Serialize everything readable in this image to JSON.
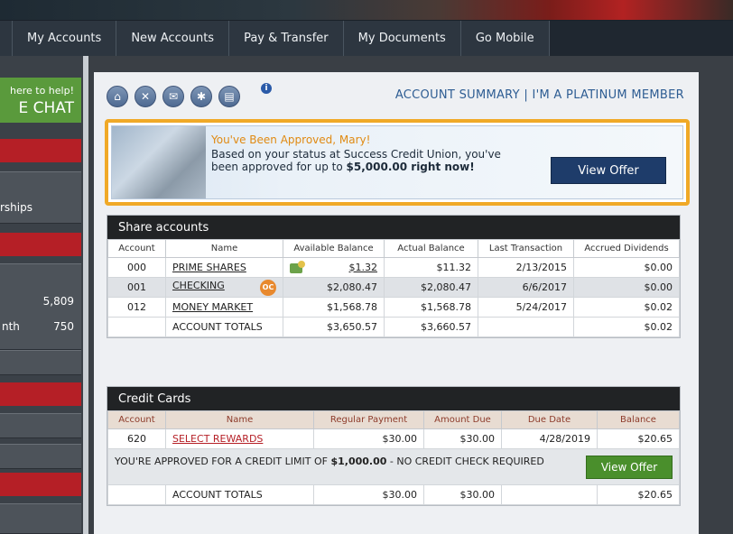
{
  "nav": {
    "tabs": [
      "My Accounts",
      "New Accounts",
      "Pay & Transfer",
      "My Documents",
      "Go Mobile"
    ]
  },
  "sidebar": {
    "help_line1": "here to help!",
    "help_line2": "E CHAT",
    "item_memberships": "rships",
    "row1_value": "5,809",
    "row2_label": "nth",
    "row2_value": "750"
  },
  "toolbar": {
    "icons": [
      "home-icon",
      "tools-icon",
      "mail-icon",
      "gear-icon",
      "print-icon"
    ],
    "info": "i"
  },
  "header": {
    "title": "ACCOUNT SUMMARY | I'M A PLATINUM MEMBER"
  },
  "offer": {
    "title": "You've Been Approved, Mary!",
    "body_prefix": "Based on your status at Success Credit Union, you've been approved for up to ",
    "body_amount": "$5,000.00 right now!",
    "button": "View Offer"
  },
  "share": {
    "heading": "Share accounts",
    "columns": [
      "Account",
      "Name",
      "Available Balance",
      "Actual Balance",
      "Last Transaction",
      "Accrued Dividends"
    ],
    "rows": [
      {
        "account": "000",
        "name": "PRIME SHARES",
        "available": "$1.32",
        "actual": "$11.32",
        "last": "2/13/2015",
        "dividends": "$0.00"
      },
      {
        "account": "001",
        "name": "CHECKING",
        "available": "$2,080.47",
        "actual": "$2,080.47",
        "last": "6/6/2017",
        "dividends": "$0.00"
      },
      {
        "account": "012",
        "name": "MONEY MARKET",
        "available": "$1,568.78",
        "actual": "$1,568.78",
        "last": "5/24/2017",
        "dividends": "$0.02"
      }
    ],
    "totals": {
      "label": "ACCOUNT TOTALS",
      "available": "$3,650.57",
      "actual": "$3,660.57",
      "dividends": "$0.02"
    },
    "badge": "OC"
  },
  "credit": {
    "heading": "Credit Cards",
    "columns": [
      "Account",
      "Name",
      "Regular Payment",
      "Amount Due",
      "Due Date",
      "Balance"
    ],
    "row": {
      "account": "620",
      "name": "SELECT REWARDS",
      "regular": "$30.00",
      "due": "$30.00",
      "date": "4/28/2019",
      "balance": "$20.65"
    },
    "approve_prefix": "YOU'RE APPROVED FOR A CREDIT LIMIT OF ",
    "approve_amount": "$1,000.00",
    "approve_suffix": " - NO CREDIT CHECK REQUIRED",
    "button": "View Offer",
    "totals": {
      "label": "ACCOUNT TOTALS",
      "regular": "$30.00",
      "due": "$30.00",
      "balance": "$20.65"
    }
  }
}
